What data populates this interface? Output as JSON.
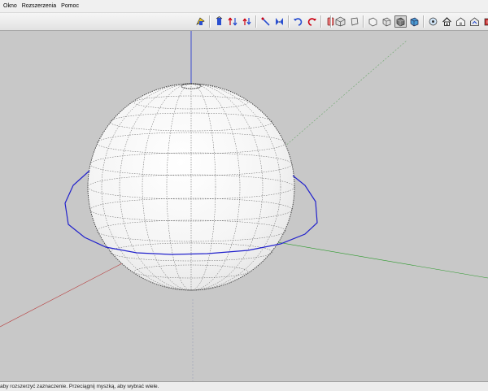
{
  "menubar": {
    "items": [
      {
        "label": "Okno"
      },
      {
        "label": "Rozszerzenia"
      },
      {
        "label": "Pomoc"
      }
    ]
  },
  "toolbar": {
    "groups": [
      {
        "buttons": [
          {
            "icon": "follow-me-icon"
          }
        ]
      },
      {
        "buttons": [
          {
            "icon": "push-pull-icon"
          },
          {
            "icon": "move-icon"
          },
          {
            "icon": "rotate-icon"
          },
          {
            "icon": "scale-icon"
          },
          {
            "icon": "offset-icon"
          },
          {
            "icon": "undo-icon"
          },
          {
            "icon": "redo-icon"
          },
          {
            "icon": "erase-icon"
          }
        ]
      },
      {
        "buttons": [
          {
            "icon": "iso-view-icon"
          },
          {
            "icon": "top-view-icon"
          },
          {
            "icon": "front-view-icon"
          },
          {
            "icon": "right-view-icon"
          },
          {
            "icon": "back-view-icon",
            "active": true
          },
          {
            "icon": "left-view-icon"
          }
        ]
      },
      {
        "buttons": [
          {
            "icon": "xray-style-icon"
          },
          {
            "icon": "home-icon"
          },
          {
            "icon": "warehouse-icon"
          },
          {
            "icon": "share-model-icon"
          },
          {
            "icon": "extension-warehouse-icon"
          }
        ]
      }
    ]
  },
  "colors": {
    "viewport_bg": "#c8c8c8",
    "axis_blue": "#1a2fd1",
    "axis_red": "#b83a3a",
    "axis_green": "#2a9a2a",
    "selection_circle": "#2222cc"
  },
  "status": {
    "text": "aby rozszerzyć zaznaczenie. Przeciągnij myszką, aby wybrać wiele."
  }
}
